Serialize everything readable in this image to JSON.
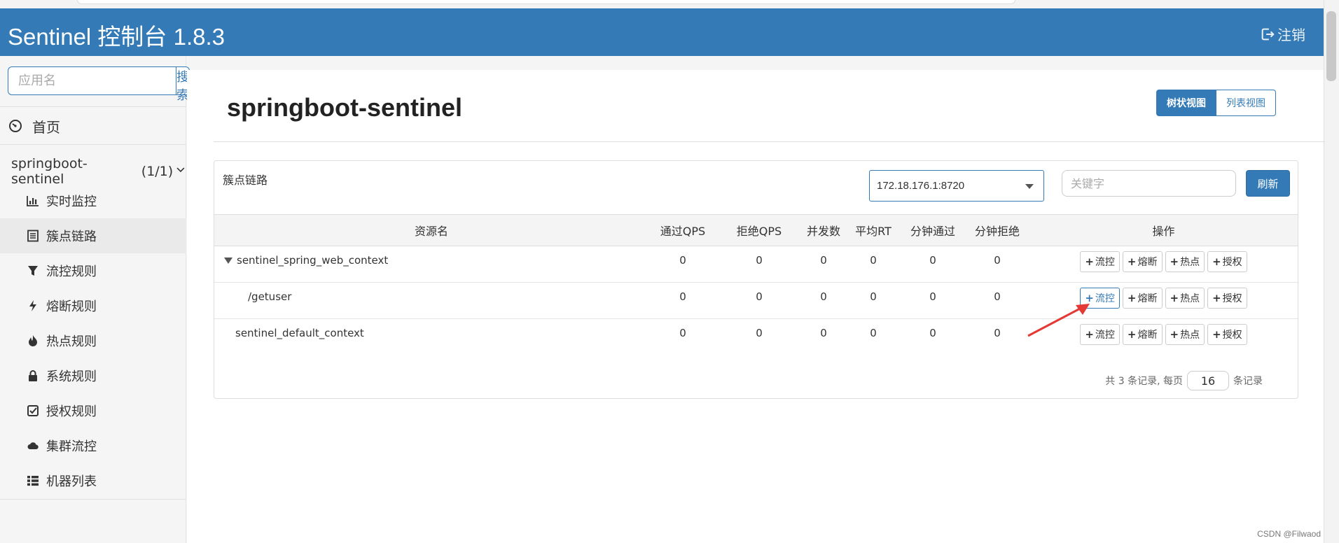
{
  "header": {
    "brand": "Sentinel 控制台 1.8.3",
    "logout_label": "注销"
  },
  "sidebar": {
    "search_placeholder": "应用名",
    "search_button": "搜索",
    "home_label": "首页",
    "app_name": "springboot-sentinel",
    "app_count": "(1/1)",
    "items": [
      {
        "label": "实时监控",
        "icon": "bar-chart-icon"
      },
      {
        "label": "簇点链路",
        "icon": "list-icon",
        "active": true
      },
      {
        "label": "流控规则",
        "icon": "filter-icon"
      },
      {
        "label": "熔断规则",
        "icon": "flash-icon"
      },
      {
        "label": "热点规则",
        "icon": "fire-icon"
      },
      {
        "label": "系统规则",
        "icon": "lock-icon"
      },
      {
        "label": "授权规则",
        "icon": "check-icon"
      },
      {
        "label": "集群流控",
        "icon": "cloud-icon"
      },
      {
        "label": "机器列表",
        "icon": "th-list-icon"
      }
    ]
  },
  "main": {
    "title": "springboot-sentinel",
    "view_tree": "树状视图",
    "view_list": "列表视图",
    "card_title": "簇点链路",
    "machine": "172.18.176.1:8720",
    "keyword_placeholder": "关键字",
    "refresh": "刷新",
    "columns": [
      "资源名",
      "通过QPS",
      "拒绝QPS",
      "并发数",
      "平均RT",
      "分钟通过",
      "分钟拒绝",
      "操作"
    ],
    "rows": [
      {
        "name": "sentinel_spring_web_context",
        "pass_qps": "0",
        "block_qps": "0",
        "threads": "0",
        "rt": "0",
        "min_pass": "0",
        "min_block": "0"
      },
      {
        "name": "/getuser",
        "pass_qps": "0",
        "block_qps": "0",
        "threads": "0",
        "rt": "0",
        "min_pass": "0",
        "min_block": "0"
      },
      {
        "name": "sentinel_default_context",
        "pass_qps": "0",
        "block_qps": "0",
        "threads": "0",
        "rt": "0",
        "min_pass": "0",
        "min_block": "0"
      }
    ],
    "ops": {
      "flow": "流控",
      "degrade": "熔断",
      "hot": "热点",
      "auth": "授权"
    },
    "pager": {
      "prefix": "共 3 条记录, 每页",
      "page_size": "16",
      "suffix": "条记录"
    }
  },
  "watermark": "CSDN @Filwaod",
  "colors": {
    "primary": "#337ab7",
    "annotation_arrow": "#e53935"
  }
}
